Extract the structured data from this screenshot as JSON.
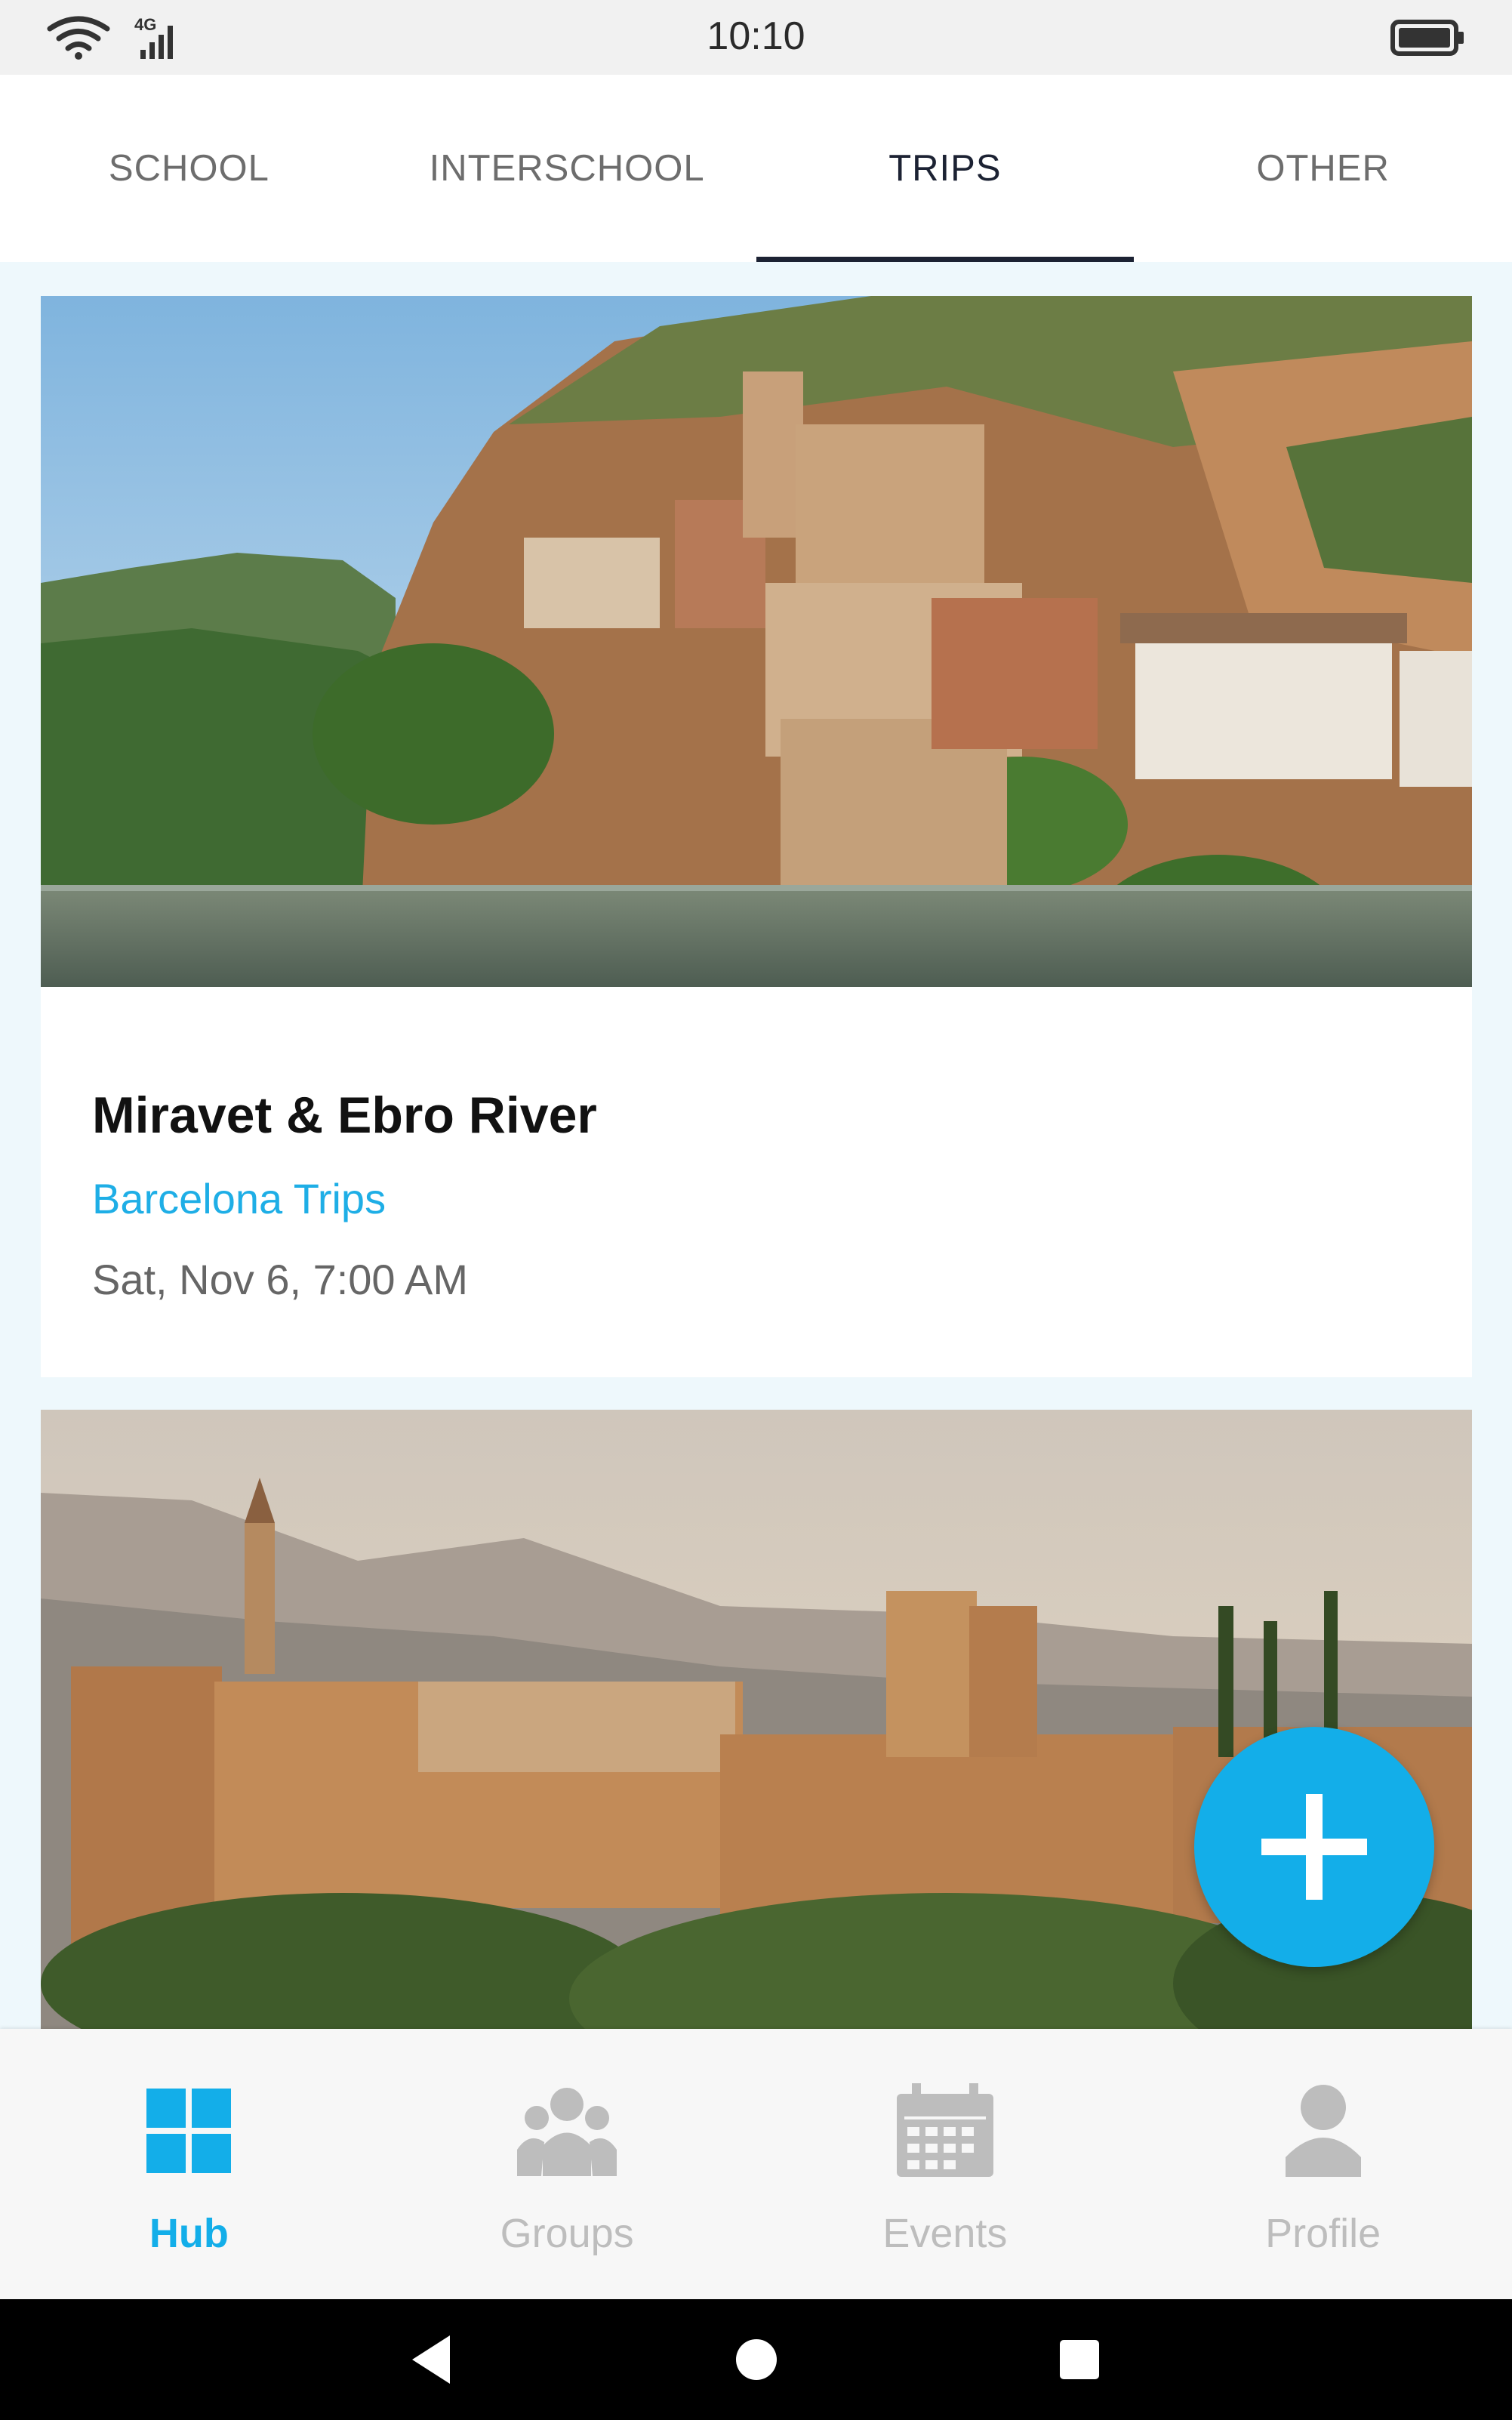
{
  "status_bar": {
    "time": "10:10",
    "network": "4G",
    "icons": [
      "wifi-icon",
      "signal-icon",
      "battery-icon"
    ]
  },
  "tabs": [
    {
      "label": "SCHOOL",
      "active": false
    },
    {
      "label": "INTERSCHOOL",
      "active": false
    },
    {
      "label": "TRIPS",
      "active": true
    },
    {
      "label": "OTHER",
      "active": false
    }
  ],
  "cards": [
    {
      "title": "Miravet & Ebro River",
      "group": "Barcelona Trips",
      "date": "Sat, Nov 6, 7:00 AM"
    }
  ],
  "fab": {
    "icon": "plus-icon"
  },
  "bottom_nav": [
    {
      "label": "Hub",
      "icon": "grid-icon",
      "active": true
    },
    {
      "label": "Groups",
      "icon": "group-icon",
      "active": false
    },
    {
      "label": "Events",
      "icon": "calendar-icon",
      "active": false
    },
    {
      "label": "Profile",
      "icon": "person-icon",
      "active": false
    }
  ],
  "system_nav": [
    "back-icon",
    "home-icon",
    "recents-icon"
  ],
  "colors": {
    "accent": "#13aee9",
    "active_tab": "#1c2233",
    "inactive": "#bdbdbd",
    "content_bg": "#eef8fc"
  }
}
